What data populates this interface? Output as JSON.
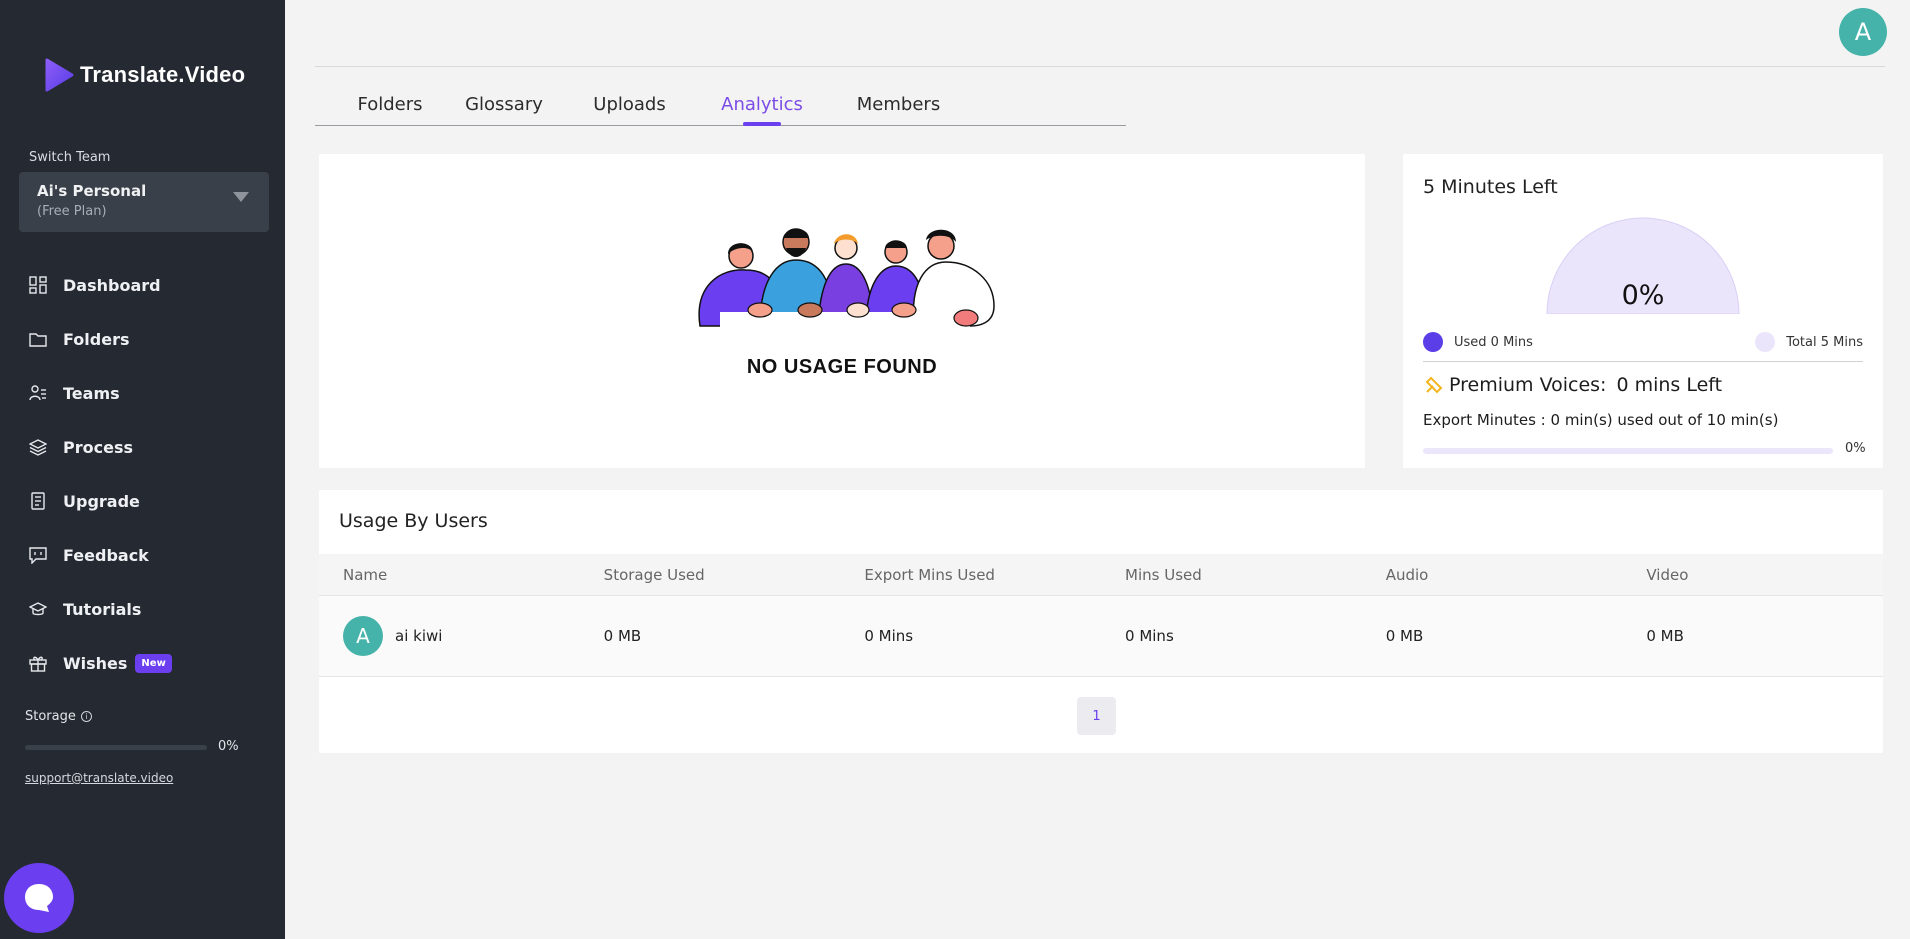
{
  "brand": {
    "name": "Translate.Video"
  },
  "sidebar": {
    "switch_team_label": "Switch Team",
    "team": {
      "name": "Ai's Personal",
      "plan": "(Free Plan)"
    },
    "items": [
      {
        "label": "Dashboard",
        "icon": "dashboard-icon"
      },
      {
        "label": "Folders",
        "icon": "folder-icon"
      },
      {
        "label": "Teams",
        "icon": "team-icon"
      },
      {
        "label": "Process",
        "icon": "layers-icon"
      },
      {
        "label": "Upgrade",
        "icon": "receipt-icon"
      },
      {
        "label": "Feedback",
        "icon": "feedback-icon"
      },
      {
        "label": "Tutorials",
        "icon": "graduation-cap-icon"
      },
      {
        "label": "Wishes",
        "icon": "gift-icon",
        "badge": "New"
      }
    ],
    "storage": {
      "label": "Storage",
      "info_glyph": "i",
      "percent": "0%",
      "fill_fraction": 0
    },
    "support_email": "support@translate.video"
  },
  "header": {
    "avatar_letter": "A"
  },
  "tabs": [
    {
      "label": "Folders",
      "active": false
    },
    {
      "label": "Glossary",
      "active": false
    },
    {
      "label": "Uploads",
      "active": false
    },
    {
      "label": "Analytics",
      "active": true
    },
    {
      "label": "Members",
      "active": false
    }
  ],
  "usage_panel": {
    "empty_text": "NO USAGE FOUND"
  },
  "minutes": {
    "title": "5 Minutes Left",
    "gauge_percent": "0%",
    "used_label": "Used 0 Mins",
    "total_label": "Total 5 Mins",
    "used_color": "#5b3ee8",
    "total_color": "#ebe5fb",
    "premium_label": "Premium Voices:",
    "premium_value": "0 mins Left",
    "export_text": "Export Minutes : 0 min(s) used out of 10 min(s)",
    "export_percent": "0%",
    "export_fill_fraction": 0
  },
  "usage_by_users": {
    "title": "Usage By Users",
    "columns": [
      "Name",
      "Storage Used",
      "Export Mins Used",
      "Mins Used",
      "Audio",
      "Video"
    ],
    "rows": [
      {
        "avatar_letter": "A",
        "name": "ai kiwi",
        "storage": "0 MB",
        "export_mins": "0 Mins",
        "mins": "0 Mins",
        "audio": "0 MB",
        "video": "0 MB"
      }
    ],
    "pagination": {
      "current": "1"
    }
  },
  "colors": {
    "accent": "#6b3ff0",
    "sidebar_bg": "#252a32",
    "avatar_bg": "#45b3a9"
  }
}
